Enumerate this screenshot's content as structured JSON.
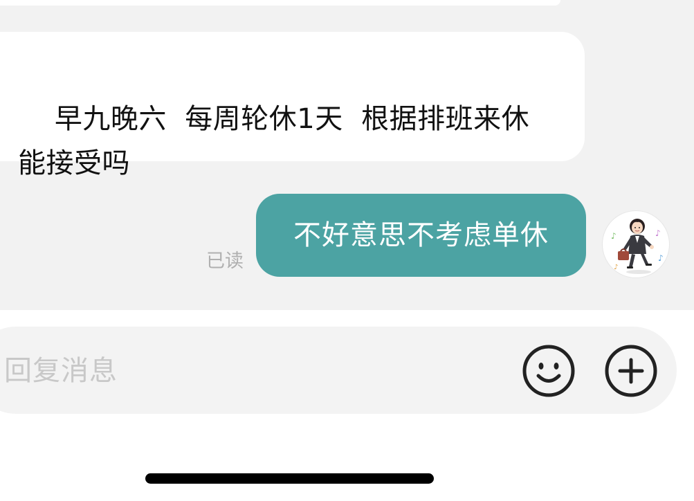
{
  "messages": {
    "incoming": {
      "text": "早九晚六  每周轮休1天  根据排班来休\n能接受吗"
    },
    "outgoing": {
      "text": "不好意思不考虑单休",
      "read_status": "已读"
    }
  },
  "composer": {
    "placeholder": "回复消息",
    "emoji_icon": "smiley-face-icon",
    "add_icon": "plus-circle-icon"
  },
  "colors": {
    "chat_background": "#f2f2f2",
    "incoming_bubble": "#ffffff",
    "outgoing_bubble": "#4ca3a3",
    "read_status": "#b0b0b0",
    "placeholder": "#c8c8c8"
  }
}
